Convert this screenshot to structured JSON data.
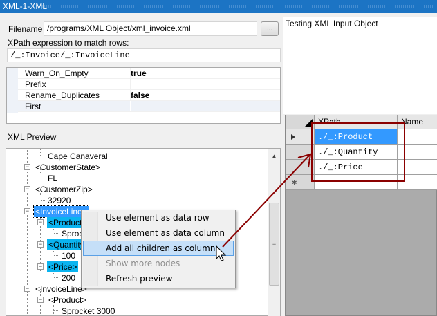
{
  "window": {
    "title": "XML-1-XML"
  },
  "form": {
    "filename_label": "Filename",
    "filename_value": "/programs/XML Object/xml_invoice.xml",
    "browse_label": "...",
    "xpath_label": "XPath expression to match rows:",
    "xpath_value": "/_:Invoice/_:InvoiceLine"
  },
  "properties": [
    {
      "name": "Warn_On_Empty",
      "value": "true"
    },
    {
      "name": "Prefix",
      "value": ""
    },
    {
      "name": "Rename_Duplicates",
      "value": "false"
    },
    {
      "name": "First",
      "value": ""
    }
  ],
  "preview": {
    "label": "XML Preview",
    "nodes": [
      "Cape Canaveral",
      "<CustomerState>",
      "FL",
      "<CustomerZip>",
      "32920",
      "<InvoiceLine>",
      "<Product>",
      "Sprocket 3000",
      "<Quantity>",
      "100",
      "<Price>",
      "200",
      "<InvoiceLine>",
      "<Product>",
      "Sprocket 3000"
    ]
  },
  "context_menu": {
    "items": [
      {
        "label": "Use element as data row",
        "state": "normal"
      },
      {
        "label": "Use element as data column",
        "state": "normal"
      },
      {
        "label": "Add all children as column",
        "state": "hover"
      },
      {
        "label": "Show more nodes",
        "state": "disabled"
      },
      {
        "label": "Refresh preview",
        "state": "normal"
      }
    ]
  },
  "description": "Testing XML Input Object",
  "columns_grid": {
    "headers": [
      "XPath",
      "Name"
    ],
    "rows": [
      {
        "xpath": "./_:Product",
        "name": ""
      },
      {
        "xpath": "./_:Quantity",
        "name": ""
      },
      {
        "xpath": "./_:Price",
        "name": ""
      }
    ]
  },
  "colors": {
    "titlebar": "#1c74c4",
    "selection": "#0ab4f0",
    "annotation": "#8b0000"
  }
}
